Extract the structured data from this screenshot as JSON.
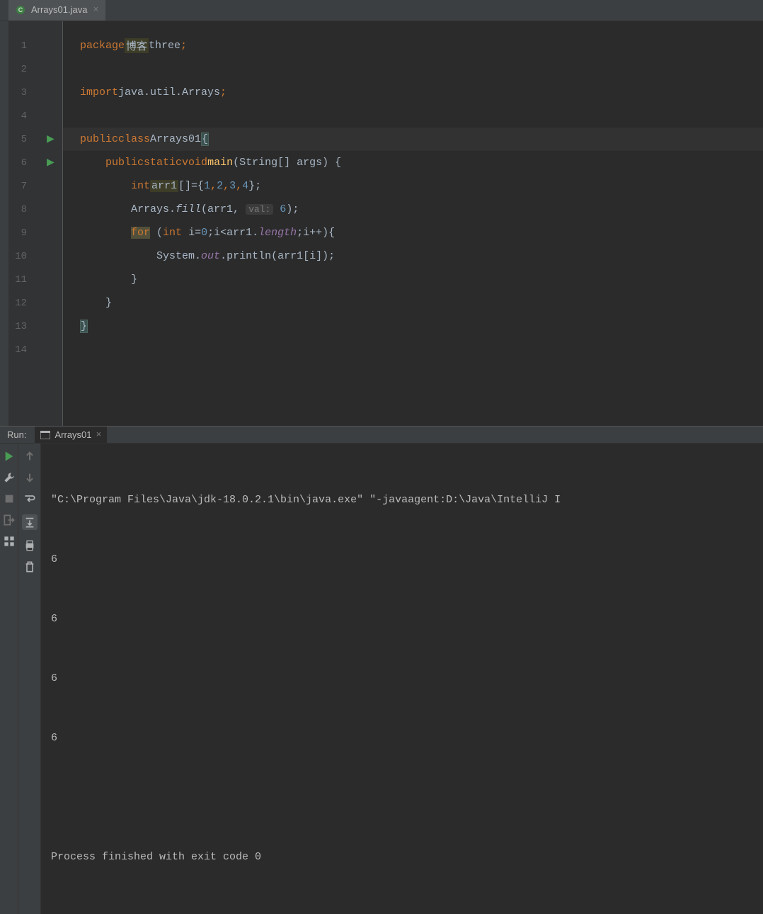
{
  "tab": {
    "label": "Arrays01.java",
    "icon": "class-icon"
  },
  "editor": {
    "lines": [
      {
        "num": 1
      },
      {
        "num": 2
      },
      {
        "num": 3
      },
      {
        "num": 4
      },
      {
        "num": 5,
        "run": true
      },
      {
        "num": 6,
        "run": true,
        "fold": true
      },
      {
        "num": 7
      },
      {
        "num": 8
      },
      {
        "num": 9,
        "fold": true
      },
      {
        "num": 10
      },
      {
        "num": 11,
        "fold_end": true
      },
      {
        "num": 12,
        "fold_end": true
      },
      {
        "num": 13
      },
      {
        "num": 14
      }
    ],
    "code": {
      "l1": {
        "kw1": "package",
        "pkg_hl": "博客",
        "pkg2": "three",
        "semi": ";"
      },
      "l3": {
        "kw1": "import",
        "pkg": "java.util.Arrays",
        "semi": ";"
      },
      "l5": {
        "kw1": "public",
        "kw2": "class",
        "name": "Arrays01",
        "brace": "{"
      },
      "l6": {
        "indent": "    ",
        "kw1": "public",
        "kw2": "static",
        "kw3": "void",
        "method": "main",
        "params": "(String[] args) {"
      },
      "l7": {
        "indent": "        ",
        "kw1": "int",
        "var_hl": "arr1",
        "decl": "[]={",
        "n1": "1",
        "c": ",",
        "n2": "2",
        "n3": "3",
        "n4": "4",
        "end": "};"
      },
      "l8": {
        "indent": "        ",
        "cls": "Arrays.",
        "method_it": "fill",
        "open": "(arr1, ",
        "hint": "val:",
        "space": " ",
        "val": "6",
        "close": ");"
      },
      "l9": {
        "indent": "        ",
        "kw_hl": "for",
        "open": " (",
        "kw2": "int",
        "var": " i",
        "eq": "=",
        "n1": "0",
        "semi1": ";i<arr1.",
        "prop": "length",
        "rest": ";i++){"
      },
      "l10": {
        "indent": "            ",
        "cls": "System.",
        "field": "out",
        "dot": ".println(arr1[",
        "var": "i",
        "close": "]);"
      },
      "l11": {
        "indent": "        ",
        "brace": "}"
      },
      "l12": {
        "indent": "    ",
        "brace": "}"
      },
      "l13": {
        "brace": "}"
      }
    }
  },
  "run": {
    "label": "Run:",
    "tab_name": "Arrays01",
    "console": [
      "\"C:\\Program Files\\Java\\jdk-18.0.2.1\\bin\\java.exe\" \"-javaagent:D:\\Java\\IntelliJ I",
      "6",
      "6",
      "6",
      "6",
      "",
      "Process finished with exit code 0"
    ]
  }
}
